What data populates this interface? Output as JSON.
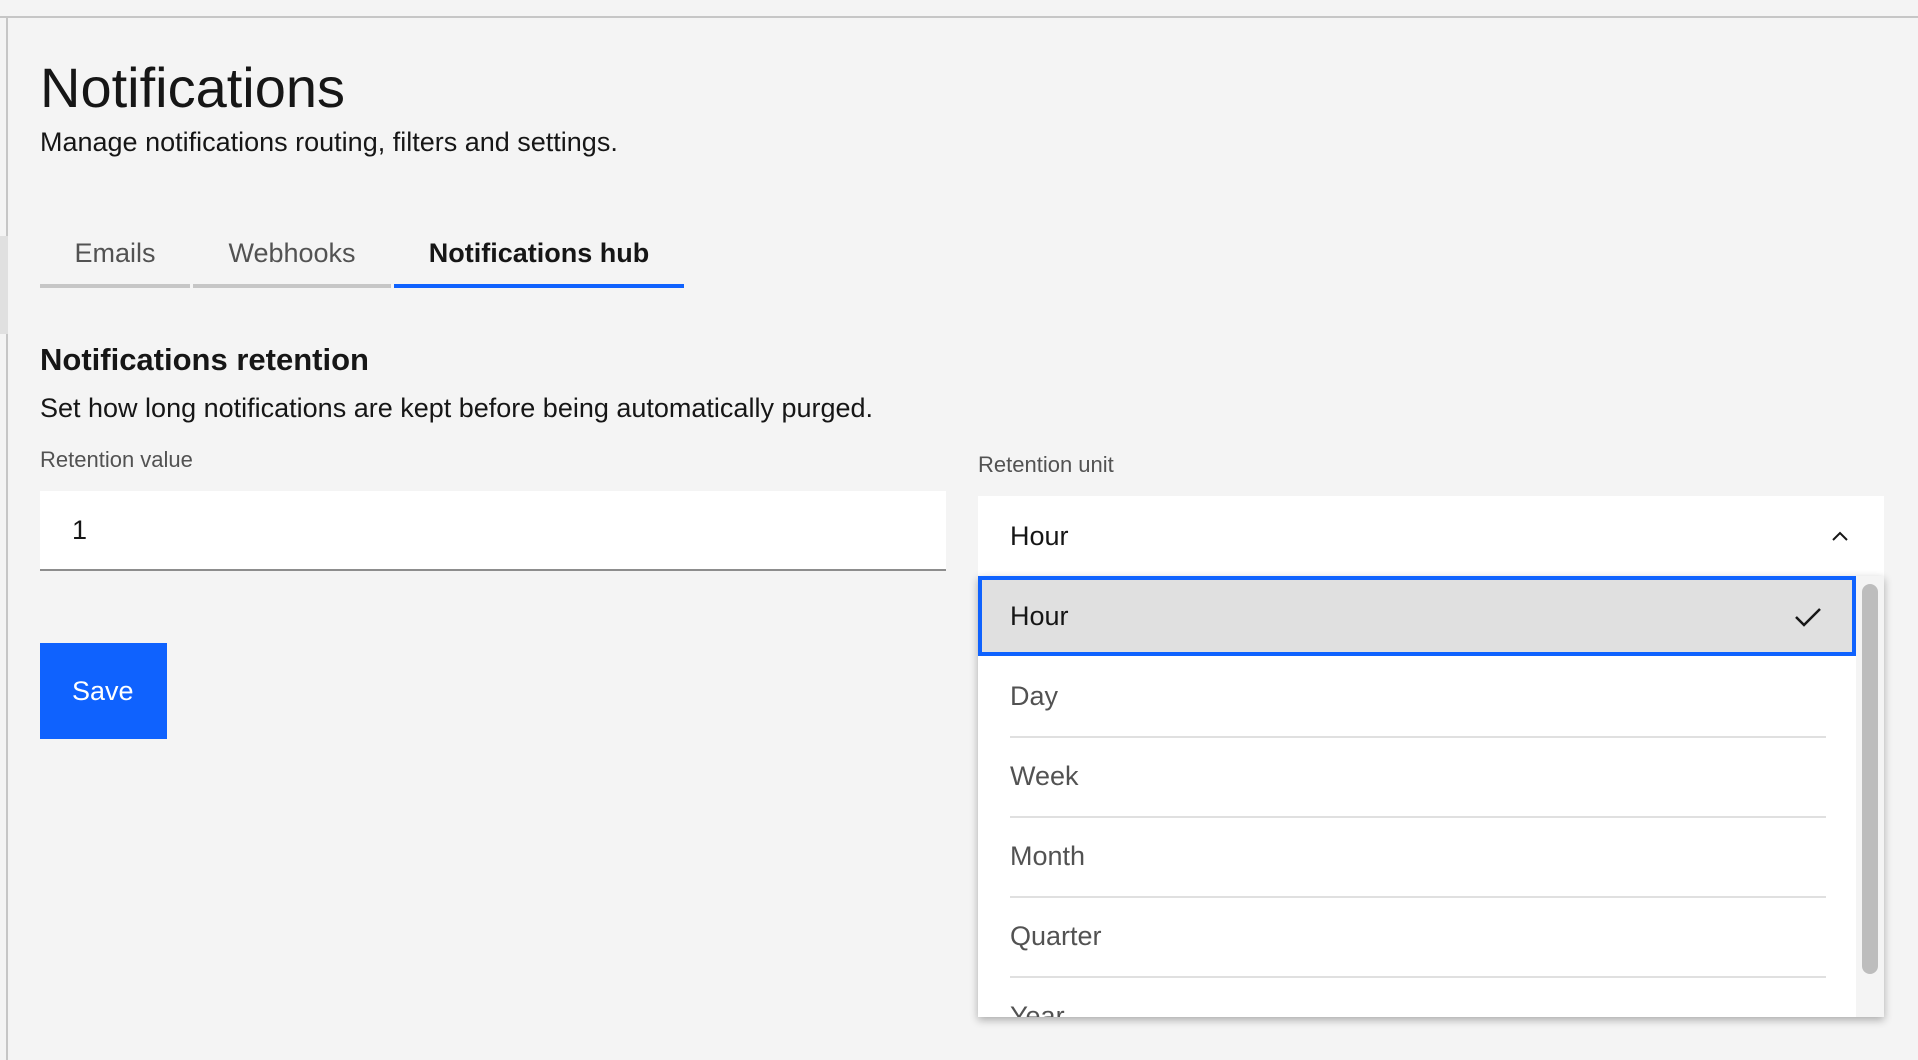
{
  "page": {
    "title": "Notifications",
    "subtitle": "Manage notifications routing, filters and settings."
  },
  "tabs": [
    {
      "label": "Emails",
      "selected": false
    },
    {
      "label": "Webhooks",
      "selected": false
    },
    {
      "label": "Notifications hub",
      "selected": true
    }
  ],
  "retention": {
    "title": "Notifications retention",
    "description": "Set how long notifications are kept before being automatically purged.",
    "value_label": "Retention value",
    "value": "1",
    "unit_label": "Retention unit",
    "unit_selected": "Hour",
    "unit_options": [
      "Hour",
      "Day",
      "Week",
      "Month",
      "Quarter",
      "Year"
    ]
  },
  "actions": {
    "save_label": "Save"
  },
  "colors": {
    "accent": "#0f62fe",
    "background": "#f4f4f4",
    "selected_option": "#e0e0e0"
  }
}
